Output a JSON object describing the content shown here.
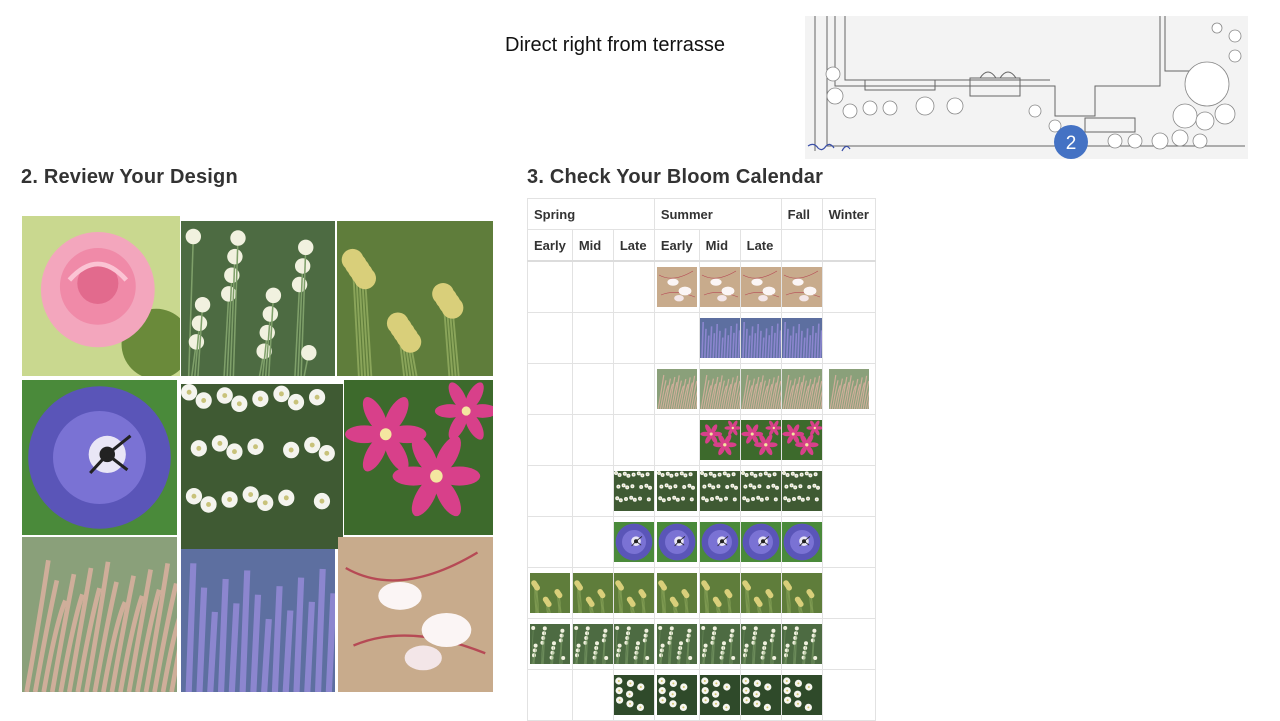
{
  "note": "Direct right from terrasse",
  "site_plan": {
    "marker_number": "2",
    "colors": {
      "marker": "#4472c4",
      "lines": "#555555",
      "handwriting": "#3a4fa8"
    }
  },
  "design": {
    "title": "2. Review Your Design",
    "photos": [
      {
        "name": "pink-rose-photo",
        "icon": "rose"
      },
      {
        "name": "white-globe-flower-photo",
        "icon": "white-buttons"
      },
      {
        "name": "yellow-globe-flower-photo",
        "icon": "yellow-buttons"
      },
      {
        "name": "blue-geranium-photo",
        "icon": "blue-geranium"
      },
      {
        "name": "white-shrub-flower-photo",
        "icon": "white-shrub"
      },
      {
        "name": "pink-clematis-photo",
        "icon": "pink-clematis"
      },
      {
        "name": "fountain-grass-photo",
        "icon": "grass"
      },
      {
        "name": "russian-sage-photo",
        "icon": "lavender"
      },
      {
        "name": "gaura-photo",
        "icon": "gaura"
      }
    ]
  },
  "calendar": {
    "title": "3. Check Your Bloom Calendar",
    "seasons": [
      "Spring",
      "Summer",
      "Fall",
      "Winter"
    ],
    "subheaders": [
      "Early",
      "Mid",
      "Late",
      "Early",
      "Mid",
      "Late",
      "",
      ""
    ],
    "rows": [
      {
        "plant": "gaura",
        "bloom": [
          0,
          0,
          0,
          1,
          1,
          1,
          1,
          0
        ]
      },
      {
        "plant": "lavender",
        "bloom": [
          0,
          0,
          0,
          0,
          1,
          1,
          1,
          0
        ]
      },
      {
        "plant": "grass",
        "bloom": [
          0,
          0,
          0,
          1,
          1,
          1,
          1,
          1
        ]
      },
      {
        "plant": "pink-clematis",
        "bloom": [
          0,
          0,
          0,
          0,
          1,
          1,
          1,
          0
        ]
      },
      {
        "plant": "white-shrub",
        "bloom": [
          0,
          0,
          1,
          1,
          1,
          1,
          1,
          0
        ]
      },
      {
        "plant": "blue-geranium",
        "bloom": [
          0,
          0,
          1,
          1,
          1,
          1,
          1,
          0
        ]
      },
      {
        "plant": "yellow-buttons",
        "bloom": [
          1,
          1,
          1,
          1,
          1,
          1,
          1,
          0
        ]
      },
      {
        "plant": "white-buttons",
        "bloom": [
          1,
          1,
          1,
          1,
          1,
          1,
          1,
          0
        ]
      },
      {
        "plant": "white-bloom",
        "bloom": [
          0,
          0,
          1,
          1,
          1,
          1,
          1,
          0
        ]
      }
    ]
  }
}
